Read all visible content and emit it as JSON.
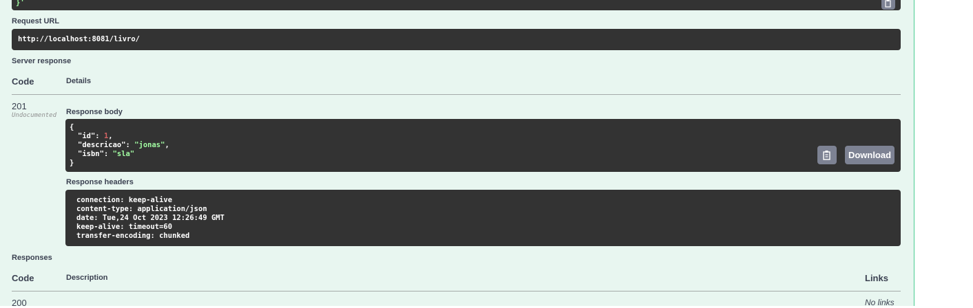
{
  "top_code": {
    "tail": "}'"
  },
  "request_url": {
    "label": "Request URL",
    "value": "http://localhost:8081/livro/"
  },
  "server_response": {
    "label": "Server response",
    "headers": {
      "code": "Code",
      "details": "Details"
    },
    "code": "201",
    "status": "Undocumented",
    "body_label": "Response body",
    "body": {
      "open": "{",
      "close": "}",
      "lines": [
        {
          "key": "\"id\"",
          "value": "1",
          "trail": ",",
          "type": "number"
        },
        {
          "key": "\"descricao\"",
          "value": "\"jonas\"",
          "trail": ",",
          "type": "string"
        },
        {
          "key": "\"isbn\"",
          "value": "\"sla\"",
          "trail": "",
          "type": "string"
        }
      ]
    },
    "download_label": "Download",
    "headers_label": "Response headers",
    "response_headers": [
      "connection: keep-alive",
      "content-type: application/json",
      "date: Tue,24 Oct 2023 12:26:49 GMT",
      "keep-alive: timeout=60",
      "transfer-encoding: chunked"
    ]
  },
  "responses": {
    "label": "Responses",
    "headers": {
      "code": "Code",
      "description": "Description",
      "links": "Links"
    },
    "first_code": "200",
    "first_links": "No links"
  },
  "icons": {
    "copy": "clipboard-copy-icon"
  }
}
